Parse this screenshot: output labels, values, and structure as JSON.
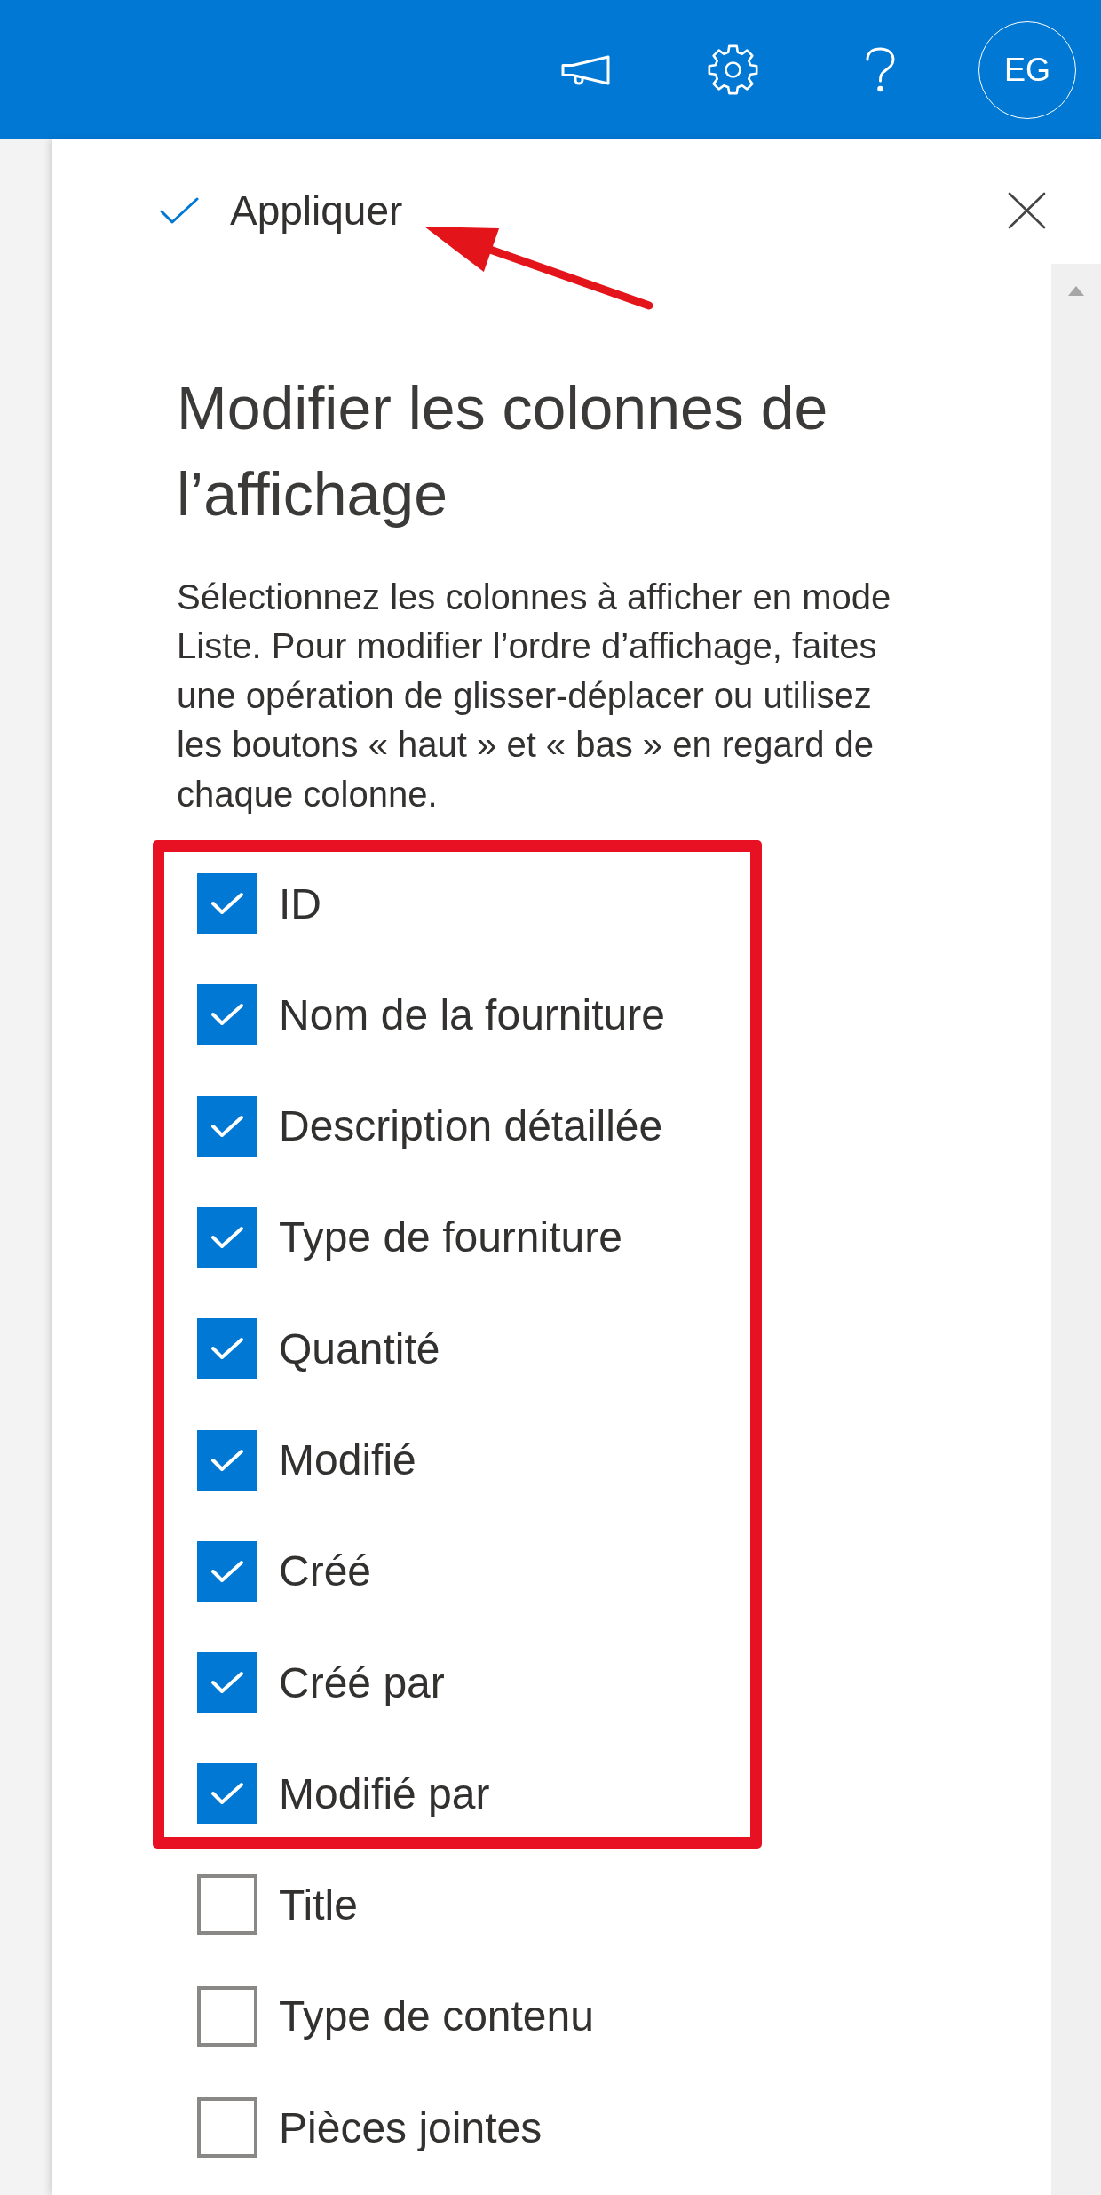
{
  "top_bar": {
    "avatar": {
      "initials": "EG"
    }
  },
  "panel": {
    "apply": {
      "label": "Appliquer",
      "annotated": true
    },
    "title": "Modifier les colonnes de l’affichage",
    "description": "Sélectionnez les colonnes à afficher en mode Liste. Pour modifier l’ordre d’affichage, faites une opération de glisser-déplacer ou utilisez les boutons « haut » et « bas » en regard de chaque colonne.",
    "column_groups": [
      {
        "kind": "framed",
        "columns": [
          {
            "label": "ID",
            "checked": true
          },
          {
            "label": "Nom de la fourniture",
            "checked": true
          },
          {
            "label": "Description détaillée",
            "checked": true
          },
          {
            "label": "Type de fourniture",
            "checked": true
          },
          {
            "label": "Quantité",
            "checked": true
          },
          {
            "label": "Modifié",
            "checked": true
          },
          {
            "label": "Créé",
            "checked": true
          },
          {
            "label": "Créé par",
            "checked": true
          },
          {
            "label": "Modifié par",
            "checked": true
          }
        ]
      },
      {
        "kind": "plain",
        "columns": [
          {
            "label": "Title",
            "checked": false
          },
          {
            "label": "Type de contenu",
            "checked": false
          },
          {
            "label": "Pièces jointes",
            "checked": false
          }
        ]
      }
    ]
  }
}
